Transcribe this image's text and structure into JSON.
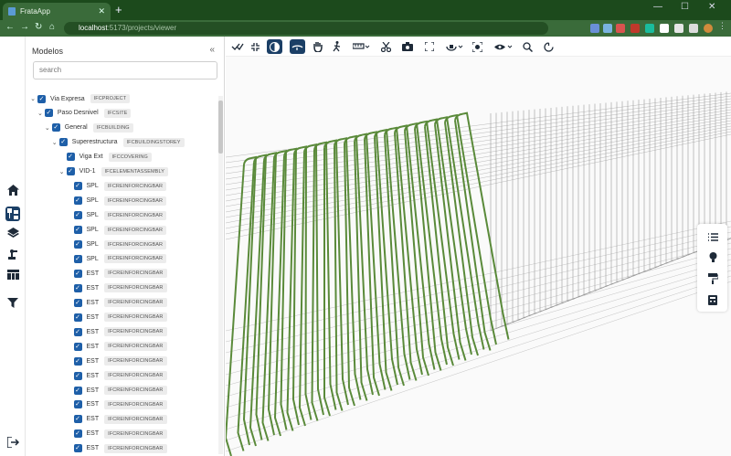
{
  "browser": {
    "tab_title": "FrataApp",
    "tab_close": "✕",
    "new_tab": "+",
    "url_host": "localhost",
    "url_path": ":5173/projects/viewer",
    "controls": {
      "minimize": "—",
      "maximize": "☐",
      "close": "✕"
    },
    "nav": {
      "back": "←",
      "forward": "→",
      "reload": "↻",
      "home": "⌂"
    }
  },
  "panel": {
    "title": "Modelos",
    "collapse": "«",
    "search_placeholder": "search"
  },
  "tree": [
    {
      "level": 0,
      "name": "Via Expresa",
      "type": "IFCPROJECT",
      "expand": "⌄"
    },
    {
      "level": 1,
      "name": "Paso Desnivel",
      "type": "IFCSITE",
      "expand": "⌄"
    },
    {
      "level": 2,
      "name": "General",
      "type": "IFCBUILDING",
      "expand": "⌄"
    },
    {
      "level": 3,
      "name": "Superestructura",
      "type": "IFCBUILDINGSTOREY",
      "expand": "⌄"
    },
    {
      "level": 4,
      "name": "Viga Ext",
      "type": "IFCCOVERING",
      "expand": ""
    },
    {
      "level": 4,
      "name": "VID-1",
      "type": "IFCELEMENTASSEMBLY",
      "expand": "⌄"
    },
    {
      "level": 5,
      "name": "SPL",
      "type": "IFCREINFORCINGBAR",
      "expand": ""
    },
    {
      "level": 5,
      "name": "SPL",
      "type": "IFCREINFORCINGBAR",
      "expand": ""
    },
    {
      "level": 5,
      "name": "SPL",
      "type": "IFCREINFORCINGBAR",
      "expand": ""
    },
    {
      "level": 5,
      "name": "SPL",
      "type": "IFCREINFORCINGBAR",
      "expand": ""
    },
    {
      "level": 5,
      "name": "SPL",
      "type": "IFCREINFORCINGBAR",
      "expand": ""
    },
    {
      "level": 5,
      "name": "SPL",
      "type": "IFCREINFORCINGBAR",
      "expand": ""
    },
    {
      "level": 5,
      "name": "EST",
      "type": "IFCREINFORCINGBAR",
      "expand": ""
    },
    {
      "level": 5,
      "name": "EST",
      "type": "IFCREINFORCINGBAR",
      "expand": ""
    },
    {
      "level": 5,
      "name": "EST",
      "type": "IFCREINFORCINGBAR",
      "expand": ""
    },
    {
      "level": 5,
      "name": "EST",
      "type": "IFCREINFORCINGBAR",
      "expand": ""
    },
    {
      "level": 5,
      "name": "EST",
      "type": "IFCREINFORCINGBAR",
      "expand": ""
    },
    {
      "level": 5,
      "name": "EST",
      "type": "IFCREINFORCINGBAR",
      "expand": ""
    },
    {
      "level": 5,
      "name": "EST",
      "type": "IFCREINFORCINGBAR",
      "expand": ""
    },
    {
      "level": 5,
      "name": "EST",
      "type": "IFCREINFORCINGBAR",
      "expand": ""
    },
    {
      "level": 5,
      "name": "EST",
      "type": "IFCREINFORCINGBAR",
      "expand": ""
    },
    {
      "level": 5,
      "name": "EST",
      "type": "IFCREINFORCINGBAR",
      "expand": ""
    },
    {
      "level": 5,
      "name": "EST",
      "type": "IFCREINFORCINGBAR",
      "expand": ""
    },
    {
      "level": 5,
      "name": "EST",
      "type": "IFCREINFORCINGBAR",
      "expand": ""
    },
    {
      "level": 5,
      "name": "EST",
      "type": "IFCREINFORCINGBAR",
      "expand": ""
    },
    {
      "level": 5,
      "name": "EST",
      "type": "IFCREINFORCINGBAR",
      "expand": ""
    }
  ],
  "rail_icons": [
    "home-icon",
    "tree-icon",
    "layers-icon",
    "robot-arm-icon",
    "table-icon",
    "filter-icon",
    "logout-icon"
  ],
  "toolbar_icons": [
    "measure-check-icon",
    "fit-view-icon",
    "contrast-icon",
    "orbit-icon",
    "pan-hand-icon",
    "walk-icon",
    "ruler-icon",
    "cut-icon",
    "camera-icon",
    "fullscreen-icon",
    "navigation-cube-icon",
    "focus-icon",
    "eye-icon",
    "zoom-icon",
    "reset-icon"
  ],
  "side_tools": [
    "list-icon",
    "lightbulb-icon",
    "paint-roller-icon",
    "calculator-icon"
  ],
  "colors": {
    "brand_dark": "#1b3f66",
    "checkbox": "#1e5fa8",
    "chrome": "#3a6b3a",
    "rebar": "#5a8a3a"
  }
}
